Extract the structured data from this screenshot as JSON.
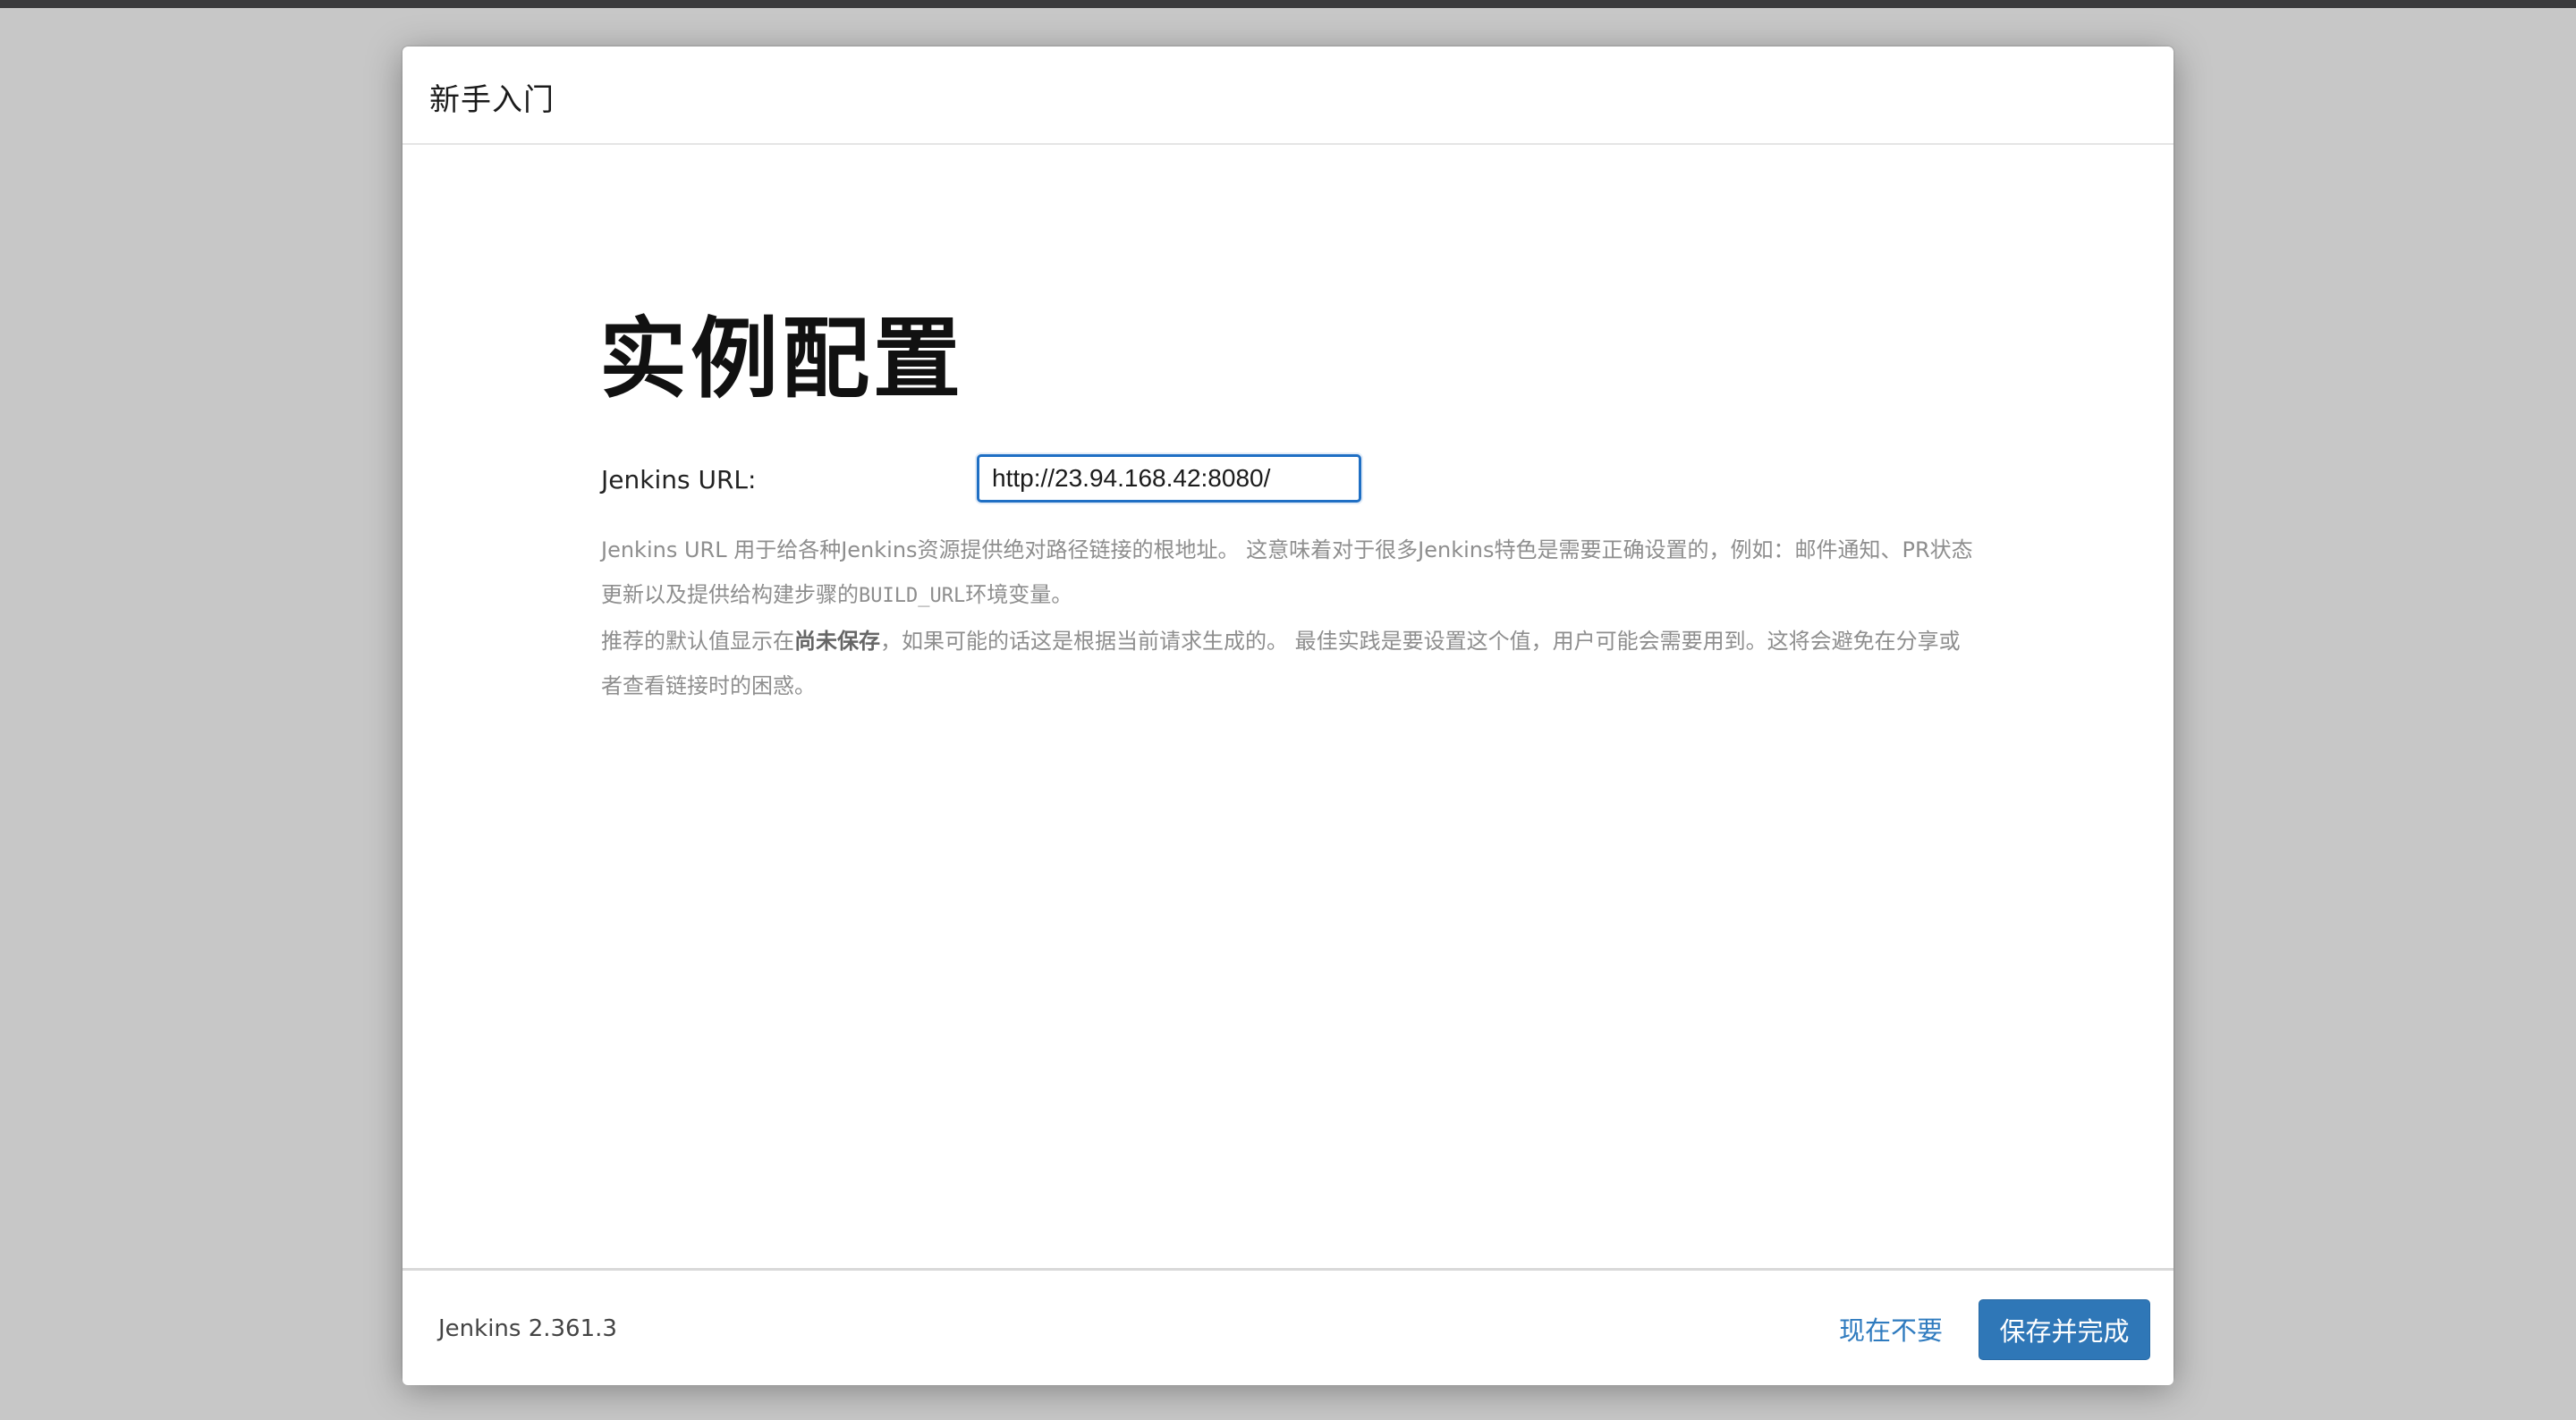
{
  "dialog": {
    "title": "新手入门"
  },
  "main": {
    "heading": "实例配置",
    "url_label": "Jenkins URL:",
    "url_value": "http://23.94.168.42:8080/",
    "help": {
      "para1_a": "Jenkins URL 用于给各种Jenkins资源提供绝对路径链接的根地址。 这意味着对于很多Jenkins特色是需要正确设置的，例如：邮件通知、PR状态更新以及提供给构建步骤的",
      "para1_code": "BUILD_URL",
      "para1_b": "环境变量。",
      "para2_a": "推荐的默认值显示在",
      "para2_bold": "尚未保存",
      "para2_b": "，如果可能的话这是根据当前请求生成的。 最佳实践是要设置这个值，用户可能会需要用到。这将会避免在分享或者查看链接时的困惑。"
    }
  },
  "footer": {
    "version": "Jenkins 2.361.3",
    "skip_label": "现在不要",
    "save_label": "保存并完成"
  },
  "colors": {
    "accent": "#2f77b7",
    "input_focus": "#1f6fc4",
    "backdrop": "#c7c7c7"
  }
}
